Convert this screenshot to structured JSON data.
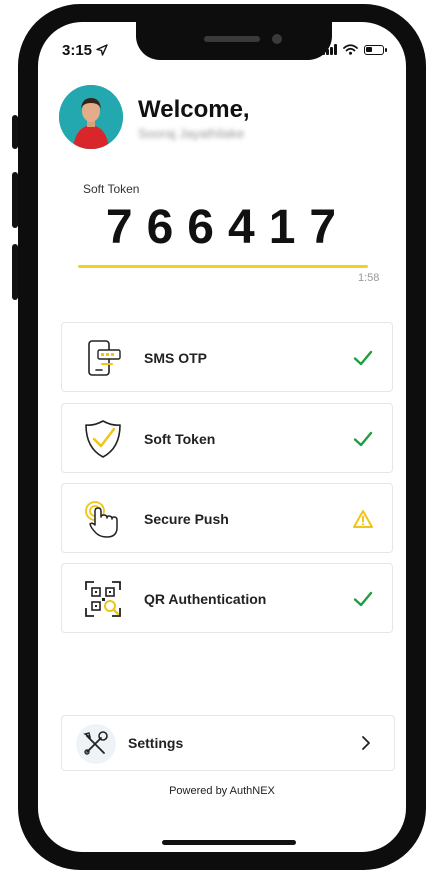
{
  "status": {
    "time": "3:15"
  },
  "header": {
    "greeting": "Welcome,",
    "username": "Sooraj Jayathilake"
  },
  "token": {
    "label": "Soft Token",
    "code": "766417",
    "timer": "1:58",
    "remaining_fraction": 0.95
  },
  "methods": [
    {
      "label": "SMS OTP",
      "icon": "sms-phone-icon",
      "status": "enabled"
    },
    {
      "label": "Soft Token",
      "icon": "shield-check-icon",
      "status": "enabled"
    },
    {
      "label": "Secure Push",
      "icon": "tap-hand-icon",
      "status": "warning"
    },
    {
      "label": "QR Authentication",
      "icon": "qr-scan-icon",
      "status": "enabled"
    }
  ],
  "settings": {
    "label": "Settings",
    "icon": "tools-icon"
  },
  "footer": {
    "powered_by": "Powered by AuthNEX"
  },
  "colors": {
    "accent_yellow": "#f2d221",
    "check_green": "#1e9e3e",
    "warning_yellow": "#f0c419",
    "avatar_bg": "#23a8b0"
  }
}
